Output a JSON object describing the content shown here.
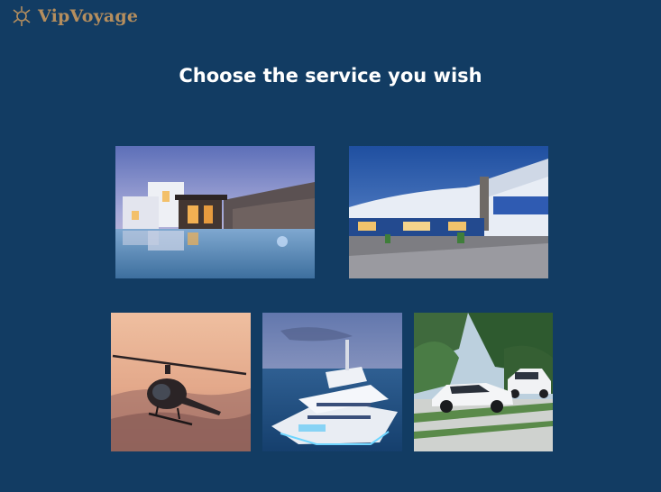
{
  "header": {
    "logo_text": "VipVoyage",
    "logo_icon": "compass-star-icon",
    "logo_color": "#b58e5e"
  },
  "main": {
    "heading": "Choose the service you wish"
  },
  "services": [
    {
      "id": "villa",
      "image": "luxury-villa-pool-photo"
    },
    {
      "id": "hotel",
      "image": "resort-hotel-photo"
    },
    {
      "id": "helicopter",
      "image": "helicopter-photo"
    },
    {
      "id": "yacht",
      "image": "superyacht-photo"
    },
    {
      "id": "car",
      "image": "luxury-cars-photo"
    }
  ],
  "colors": {
    "background": "#123c63",
    "heading": "#ffffff"
  }
}
